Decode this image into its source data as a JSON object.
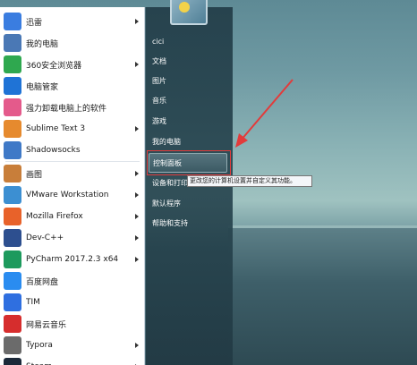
{
  "start_menu": {
    "programs": [
      {
        "label": "迅雷",
        "icon": "xunlei-icon",
        "color": "#3a7de0",
        "submenu": true
      },
      {
        "label": "我的电脑",
        "icon": "computer-icon",
        "color": "#4a78b5",
        "submenu": false
      },
      {
        "label": "360安全浏览器",
        "icon": "360-browser-icon",
        "color": "#2fa84f",
        "submenu": true
      },
      {
        "label": "电脑管家",
        "icon": "pc-manager-icon",
        "color": "#1f73d6",
        "submenu": false
      },
      {
        "label": "强力卸载电脑上的软件",
        "icon": "uninstaller-icon",
        "color": "#e45a8b",
        "submenu": false
      },
      {
        "label": "Sublime Text 3",
        "icon": "sublime-icon",
        "color": "#e68a2e",
        "submenu": true
      },
      {
        "label": "Shadowsocks",
        "icon": "shadowsocks-icon",
        "color": "#3f79c7",
        "submenu": false
      },
      {
        "label": "画图",
        "icon": "paint-icon",
        "color": "#c87e3a",
        "submenu": true
      },
      {
        "label": "VMware Workstation",
        "icon": "vmware-icon",
        "color": "#3c8fd2",
        "submenu": true
      },
      {
        "label": "Mozilla Firefox",
        "icon": "firefox-icon",
        "color": "#e8622a",
        "submenu": true
      },
      {
        "label": "Dev-C++",
        "icon": "devcpp-icon",
        "color": "#2d4f8f",
        "submenu": true
      },
      {
        "label": "PyCharm 2017.2.3 x64",
        "icon": "pycharm-icon",
        "color": "#1d9a5d",
        "submenu": true
      },
      {
        "label": "百度网盘",
        "icon": "baidu-netdisk-icon",
        "color": "#2a8cf0",
        "submenu": false
      },
      {
        "label": "TIM",
        "icon": "tim-icon",
        "color": "#2f6fe0",
        "submenu": false
      },
      {
        "label": "网易云音乐",
        "icon": "netease-music-icon",
        "color": "#d62d2d",
        "submenu": false
      },
      {
        "label": "Typora",
        "icon": "typora-icon",
        "color": "#6b6b6b",
        "submenu": true
      },
      {
        "label": "Steam",
        "icon": "steam-icon",
        "color": "#1b2838",
        "submenu": true
      }
    ],
    "right_items": [
      {
        "label": "cici",
        "name": "user-folder-link"
      },
      {
        "label": "文档",
        "name": "documents-link"
      },
      {
        "label": "图片",
        "name": "pictures-link"
      },
      {
        "label": "音乐",
        "name": "music-link"
      },
      {
        "label": "游戏",
        "name": "games-link"
      },
      {
        "label": "我的电脑",
        "name": "computer-link"
      },
      {
        "label": "控制面板",
        "name": "control-panel-link"
      },
      {
        "label": "设备和打印",
        "name": "devices-printers-link"
      },
      {
        "label": "默认程序",
        "name": "default-programs-link"
      },
      {
        "label": "帮助和支持",
        "name": "help-support-link"
      }
    ],
    "tooltip": "更改您的计算机设置并自定义其功能。",
    "highlight_color": "#e23b3b"
  }
}
